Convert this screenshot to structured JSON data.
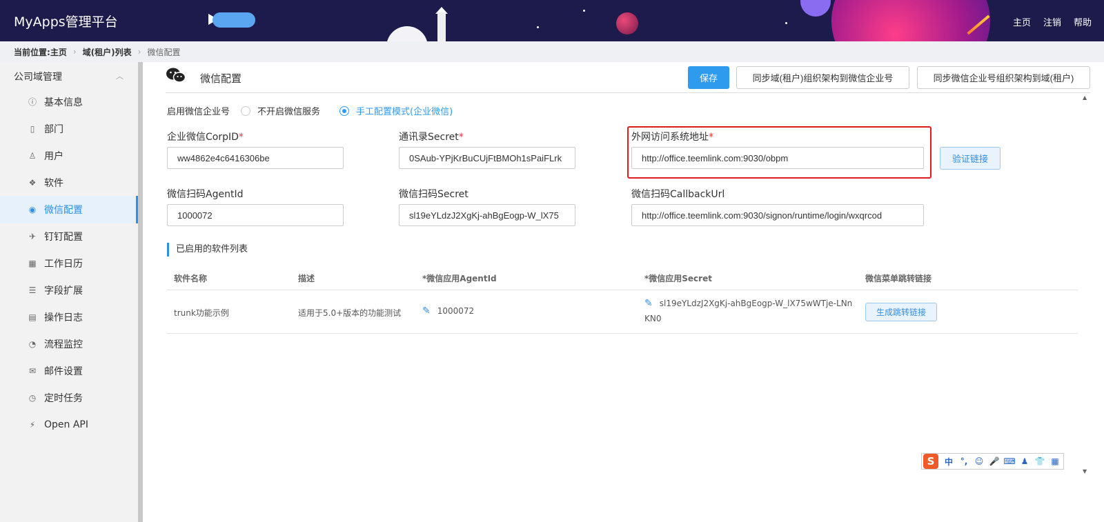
{
  "header": {
    "brand": "MyApps管理平台",
    "nav": [
      "主页",
      "注销",
      "帮助"
    ]
  },
  "breadcrumb": {
    "prefix": "当前位置:",
    "items": [
      "主页",
      "域(租户)列表",
      "微信配置"
    ]
  },
  "sidebar": {
    "group_title": "公司域管理",
    "items": [
      {
        "label": "基本信息",
        "icon": "info-icon"
      },
      {
        "label": "部门",
        "icon": "building-icon"
      },
      {
        "label": "用户",
        "icon": "user-icon"
      },
      {
        "label": "软件",
        "icon": "cubes-icon"
      },
      {
        "label": "微信配置",
        "icon": "wechat-icon",
        "active": true
      },
      {
        "label": "钉钉配置",
        "icon": "plane-icon"
      },
      {
        "label": "工作日历",
        "icon": "calendar-icon"
      },
      {
        "label": "字段扩展",
        "icon": "sliders-icon"
      },
      {
        "label": "操作日志",
        "icon": "log-icon"
      },
      {
        "label": "流程监控",
        "icon": "dashboard-icon"
      },
      {
        "label": "邮件设置",
        "icon": "mail-icon"
      },
      {
        "label": "定时任务",
        "icon": "clock-icon"
      },
      {
        "label": "Open API",
        "icon": "plug-icon"
      }
    ]
  },
  "main": {
    "title": "微信配置",
    "buttons": {
      "save": "保存",
      "sync_to_wechat": "同步域(租户)组织架构到微信企业号",
      "sync_from_wechat": "同步微信企业号组织架构到域(租户)"
    },
    "enable": {
      "label": "启用微信企业号",
      "options": [
        "不开启微信服务",
        "手工配置模式(企业微信)"
      ],
      "selected": "手工配置模式(企业微信)"
    },
    "fields": {
      "corp_id": {
        "label": "企业微信CorpID",
        "value": "ww4862e4c6416306be"
      },
      "contacts_secret": {
        "label": "通讯录Secret",
        "value": "0SAub-YPjKrBuCUjFtBMOh1sPaiFLrk"
      },
      "external_url": {
        "label": "外网访问系统地址",
        "value": "http://office.teemlink.com:9030/obpm"
      },
      "agent_id": {
        "label": "微信扫码AgentId",
        "value": "1000072"
      },
      "scan_secret": {
        "label": "微信扫码Secret",
        "value": "sl19eYLdzJ2XgKj-ahBgEogp-W_lX75"
      },
      "callback_url": {
        "label": "微信扫码CallbackUrl",
        "value": "http://office.teemlink.com:9030/signon/runtime/login/wxqrcod"
      }
    },
    "required_mark": "*",
    "verify_button": "验证链接",
    "section_title": "已启用的软件列表",
    "table": {
      "headers": [
        "软件名称",
        "描述",
        "*微信应用AgentId",
        "*微信应用Secret",
        "微信菜单跳转链接"
      ],
      "rows": [
        {
          "name": "trunk功能示例",
          "desc": "适用于5.0+版本的功能测试",
          "agent_id": "1000072",
          "secret_line1": "sl19eYLdzJ2XgKj-ahBgEogp-W_lX75wWTje-LNn",
          "secret_line2": "KN0",
          "action": "生成跳转链接"
        }
      ]
    }
  },
  "ime": {
    "logo": "S",
    "tools": [
      "中",
      "°,",
      "☺",
      "🎤",
      "⌨",
      "♟",
      "👕",
      "▦"
    ]
  }
}
